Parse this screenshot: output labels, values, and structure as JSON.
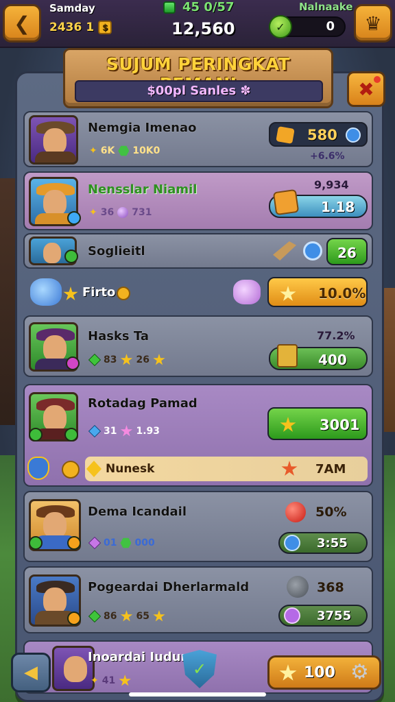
{
  "header": {
    "player_name": "Samday",
    "player_stat": "2436",
    "player_level": "1",
    "gems": "45 0/57",
    "score": "12,560",
    "currency_label": "Nalnaake",
    "currency_value": "0"
  },
  "panel": {
    "title": "SUJUM PERINGKAT PEMANI",
    "subtitle": "$00pl Sanles ✽"
  },
  "rows": [
    {
      "name": "Nemgia Imenao",
      "stat1": "6K",
      "stat2": "10K0",
      "value": "580",
      "subvalue": "+6.6%"
    },
    {
      "name": "Nensslar Niamil",
      "stat1": "36",
      "stat2": "731",
      "value_top": "9,934",
      "value": "1.18"
    },
    {
      "name": "Soglieitl",
      "value": "26"
    },
    {
      "name": "Firto",
      "value": "10.0%"
    },
    {
      "name": "Hasks Ta",
      "stat1": "83",
      "stat2": "26",
      "value_top": "77.2%",
      "value": "400"
    },
    {
      "name": "Rotadag Pamad",
      "stat1": "31",
      "stat2": "1.93",
      "value": "3001"
    },
    {
      "name": "Nunesk",
      "value": "7AM"
    },
    {
      "name": "Dema Icandail",
      "stat1": "01",
      "stat2": "000",
      "value_top": "50%",
      "value": "3:55"
    },
    {
      "name": "Pogeardai Dherlarmald",
      "stat1": "86",
      "stat2": "65",
      "value_top": "368",
      "value": "3755"
    },
    {
      "name": "Inoardai Iudur",
      "stat1": "41"
    }
  ],
  "footer": {
    "reward_value": "100"
  },
  "colors": {
    "accent_gold": "#f5b23a",
    "accent_green": "#3ea52a",
    "panel": "#5d6a83"
  }
}
